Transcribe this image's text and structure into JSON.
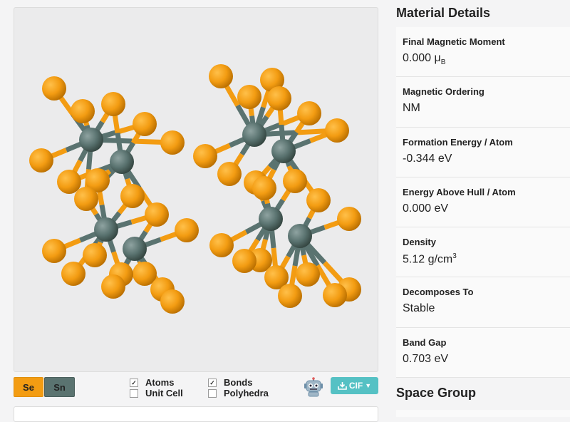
{
  "viewer": {
    "elements": [
      {
        "label": "Se",
        "color": "#f39c12"
      },
      {
        "label": "Sn",
        "color": "#5a7370"
      }
    ],
    "toggles": [
      {
        "label": "Atoms",
        "checked": true
      },
      {
        "label": "Unit Cell",
        "checked": false
      },
      {
        "label": "Bonds",
        "checked": true
      },
      {
        "label": "Polyhedra",
        "checked": false
      }
    ],
    "robot_icon": "robot-icon",
    "download": {
      "label": "CIF",
      "icon": "download-icon"
    }
  },
  "material_details": {
    "title": "Material Details",
    "items": [
      {
        "label": "Final Magnetic Moment",
        "value": "0.000 μ",
        "subscript": "B"
      },
      {
        "label": "Magnetic Ordering",
        "value": "NM"
      },
      {
        "label": "Formation Energy / Atom",
        "value": "-0.344 eV"
      },
      {
        "label": "Energy Above Hull / Atom",
        "value": "0.000 eV"
      },
      {
        "label": "Density",
        "value": "5.12 g/cm",
        "superscript": "3"
      },
      {
        "label": "Decomposes To",
        "value": "Stable"
      },
      {
        "label": "Band Gap",
        "value": "0.703 eV"
      }
    ]
  },
  "space_group": {
    "title": "Space Group"
  }
}
